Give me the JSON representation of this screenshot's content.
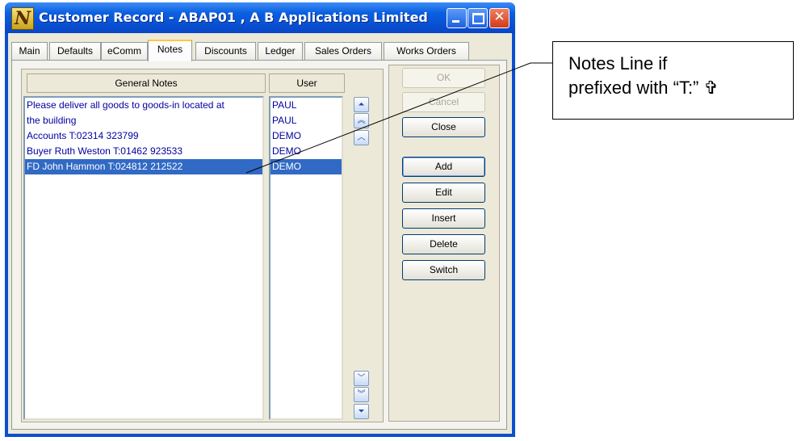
{
  "window": {
    "app_icon_letter": "N",
    "title": "Customer Record - ABAP01 , A B Applications Limited",
    "close_glyph": "✕"
  },
  "tabs": [
    {
      "label": "Main"
    },
    {
      "label": "Defaults"
    },
    {
      "label": "eComm"
    },
    {
      "label": "Notes",
      "active": true
    },
    {
      "label": "Discounts"
    },
    {
      "label": "Ledger"
    },
    {
      "label": "Sales Orders"
    },
    {
      "label": "Works Orders"
    }
  ],
  "notes": {
    "headers": {
      "notes": "General Notes",
      "user": "User"
    },
    "rows": [
      {
        "note": "Please deliver all goods to goods-in located at",
        "user": "PAUL"
      },
      {
        "note": "the building",
        "user": "PAUL"
      },
      {
        "note": "Accounts T:02314 323799",
        "user": "DEMO"
      },
      {
        "note": "Buyer Ruth Weston  T:01462 923533",
        "user": "DEMO"
      },
      {
        "note": "FD John Hammon T:024812 212522",
        "user": "DEMO",
        "selected": true
      }
    ],
    "scroll_icons": [
      "scroll-up-icon",
      "page-up-icon",
      "line-up-icon",
      "line-down-icon",
      "page-down-icon",
      "scroll-down-icon"
    ]
  },
  "buttons": {
    "ok": "OK",
    "cancel": "Cancel",
    "close": "Close",
    "add": "Add",
    "edit": "Edit",
    "insert": "Insert",
    "delete": "Delete",
    "switch": "Switch"
  },
  "callout": {
    "text": "Notes Line if\nprefixed with “T:” ✞"
  },
  "colors": {
    "titlebar": "#0a5fe0",
    "selection": "#316ac5",
    "note_text": "#0000a0",
    "active_tab_accent": "#ffc83c"
  }
}
